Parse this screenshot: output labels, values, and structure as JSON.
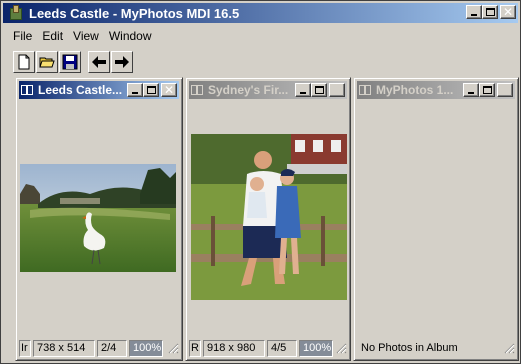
{
  "app": {
    "title": "Leeds Castle - MyPhotos MDI 16.5",
    "icon": "app-icon"
  },
  "menu": {
    "file": "File",
    "edit": "Edit",
    "view": "View",
    "window": "Window"
  },
  "toolbar": {
    "buttons": [
      "new-icon",
      "open-folder-icon",
      "save-icon",
      "arrow-left-icon",
      "arrow-right-icon"
    ]
  },
  "children": [
    {
      "title": "Leeds Castle...",
      "status": {
        "mode": "Ir",
        "size": "738 x 514",
        "index": "2/4",
        "zoom": "100%"
      }
    },
    {
      "title": "Sydney's Fir...",
      "status": {
        "mode": "R",
        "size": "918 x 980",
        "index": "4/5",
        "zoom": "100%"
      }
    },
    {
      "title": "MyPhotos 1...",
      "status": {
        "message": "No Photos in Album"
      }
    }
  ],
  "colors": {
    "active_title": "#0a246a",
    "inactive_title": "#808080",
    "face": "#d4d0c8"
  }
}
